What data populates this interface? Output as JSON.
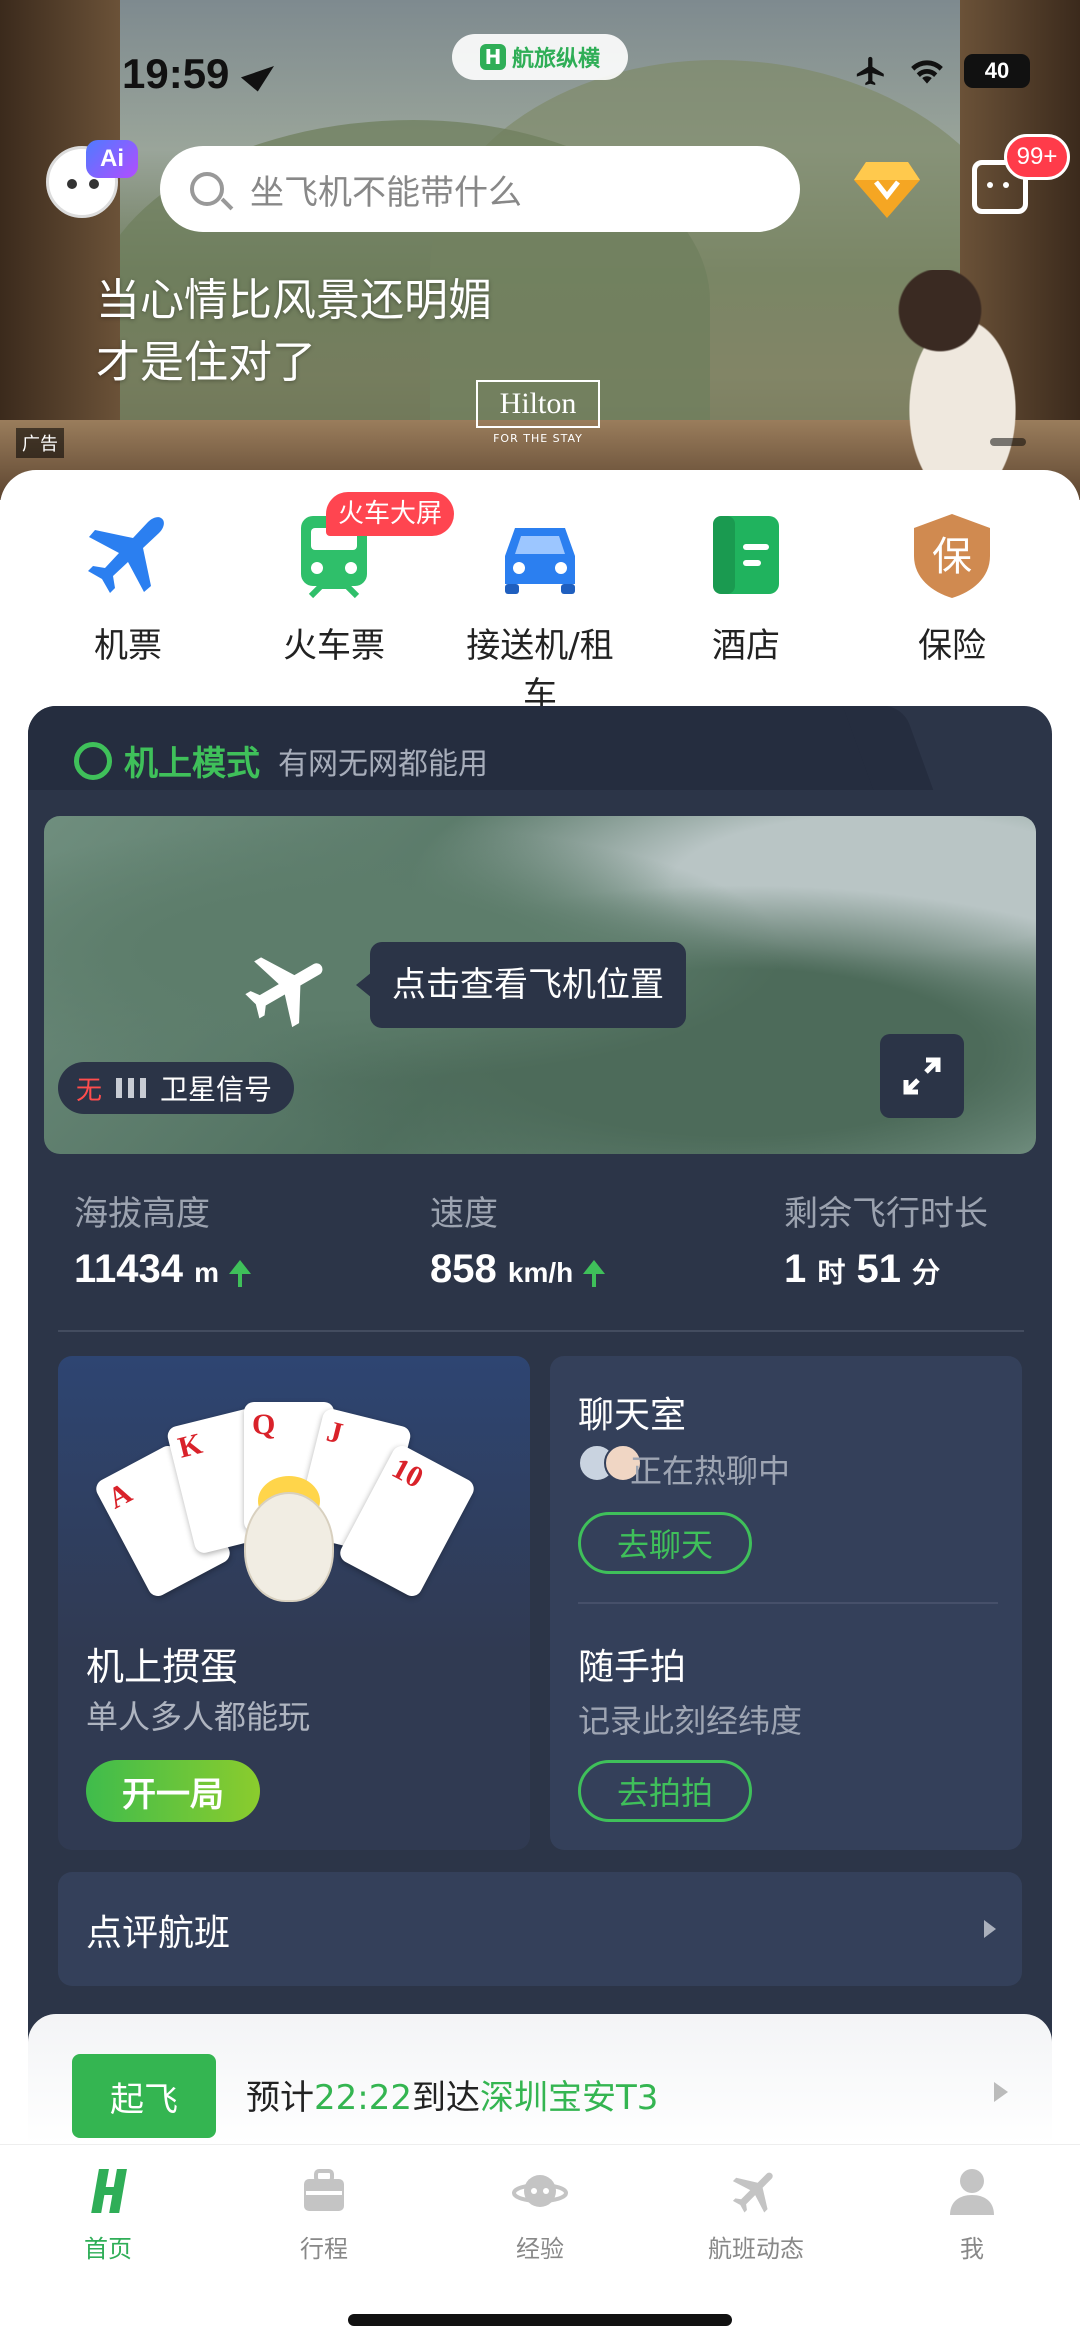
{
  "status_bar": {
    "time": "19:59",
    "brand_name": "航旅纵横",
    "battery": "40"
  },
  "search": {
    "placeholder": "坐飞机不能带什么"
  },
  "ai_badge": "Ai",
  "message_badge": "99+",
  "ad": {
    "line1": "当心情比风景还明媚",
    "line2": "才是住对了",
    "brand": "Hilton",
    "brand_tagline": "FOR THE STAY",
    "tag": "广告"
  },
  "services": [
    {
      "label": "机票",
      "icon": "airplane-icon"
    },
    {
      "label": "火车票",
      "icon": "train-icon",
      "badge": "火车大屏"
    },
    {
      "label": "接送机/租车",
      "icon": "car-icon"
    },
    {
      "label": "酒店",
      "icon": "hotel-icon"
    },
    {
      "label": "保险",
      "icon": "insurance-icon",
      "glyph": "保"
    }
  ],
  "flight_mode": {
    "title": "机上模式",
    "subtitle": "有网无网都能用",
    "map_tip": "点击查看飞机位置",
    "signal_prefix": "无",
    "signal_label": "卫星信号"
  },
  "stats": {
    "altitude": {
      "label": "海拔高度",
      "value": "11434",
      "unit": "m"
    },
    "speed": {
      "label": "速度",
      "value": "858",
      "unit": "km/h"
    },
    "remaining": {
      "label": "剩余飞行时长",
      "hours": "1",
      "hours_unit": "时",
      "minutes": "51",
      "minutes_unit": "分"
    }
  },
  "game": {
    "title": "机上掼蛋",
    "subtitle": "单人多人都能玩",
    "button": "开一局",
    "cards": [
      "A",
      "K",
      "Q",
      "J",
      "10"
    ]
  },
  "chat": {
    "title": "聊天室",
    "status": "正在热聊中",
    "button": "去聊天"
  },
  "photo": {
    "title": "随手拍",
    "subtitle": "记录此刻经纬度",
    "button": "去拍拍"
  },
  "review": {
    "title": "点评航班"
  },
  "departure": {
    "chip": "起飞",
    "prefix": "预计",
    "time": "22:22",
    "mid": "到达",
    "airport": "深圳宝安T3"
  },
  "tabs": [
    {
      "label": "首页",
      "active": true
    },
    {
      "label": "行程",
      "active": false
    },
    {
      "label": "经验",
      "active": false
    },
    {
      "label": "航班动态",
      "active": false
    },
    {
      "label": "我",
      "active": false
    }
  ],
  "colors": {
    "accent": "#2fae57",
    "card_bg": "#2c3548",
    "badge_red": "#ff3b4a"
  }
}
